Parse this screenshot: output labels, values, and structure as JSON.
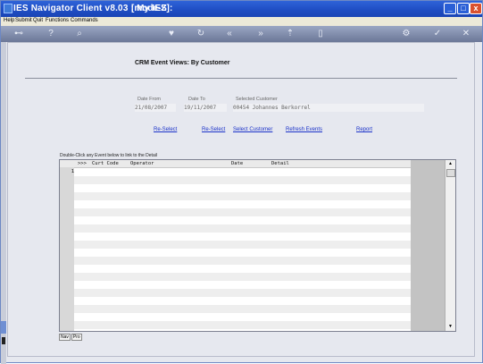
{
  "window": {
    "title": "IES Navigator Client v8.03 : My IES :",
    "mode": "[mode-Z]",
    "min_symbol": "_",
    "max_symbol": "□",
    "close_symbol": "x"
  },
  "menu": [
    "Help",
    "Submit",
    "Quit",
    "Functions",
    "Commands"
  ],
  "toolbar": {
    "icons": [
      {
        "name": "home-icon",
        "glyph": "⊷"
      },
      {
        "name": "help-icon",
        "glyph": "?"
      },
      {
        "name": "search-icon",
        "glyph": "⌕"
      },
      {
        "name": "favorite-icon",
        "glyph": "♥"
      },
      {
        "name": "refresh-icon",
        "glyph": "↻"
      },
      {
        "name": "back-icon",
        "glyph": "«"
      },
      {
        "name": "forward-icon",
        "glyph": "»"
      },
      {
        "name": "up-icon",
        "glyph": "⇡"
      },
      {
        "name": "page-icon",
        "glyph": "▯"
      },
      {
        "name": "settings-icon",
        "glyph": "⚙"
      },
      {
        "name": "ok-icon",
        "glyph": "✓"
      },
      {
        "name": "close-icon",
        "glyph": "✕"
      }
    ]
  },
  "page": {
    "title": "CRM Event Views: By Customer"
  },
  "filters": {
    "date_from_label": "Date From",
    "date_from_value": "21/08/2007",
    "date_to_label": "Date To",
    "date_to_value": "19/11/2007",
    "customer_label": "Selected Customer",
    "customer_value": "00454 Johannes Berkorrel"
  },
  "actions": {
    "reselect_1": "Re-Select",
    "reselect_2": "Re-Select",
    "select_customer": "Select Customer",
    "refresh_events": "Refresh Events",
    "report": "Report"
  },
  "grid": {
    "hint": "Double-Click any Event below to link to the Detail",
    "columns": [
      ">>>",
      "Curt Code",
      "Operator",
      "Date",
      "Detail"
    ],
    "row_numbers": [
      "1"
    ]
  },
  "tabs": [
    "Nav",
    "Pro"
  ],
  "scroll": {
    "up": "▲",
    "down": "▼"
  }
}
